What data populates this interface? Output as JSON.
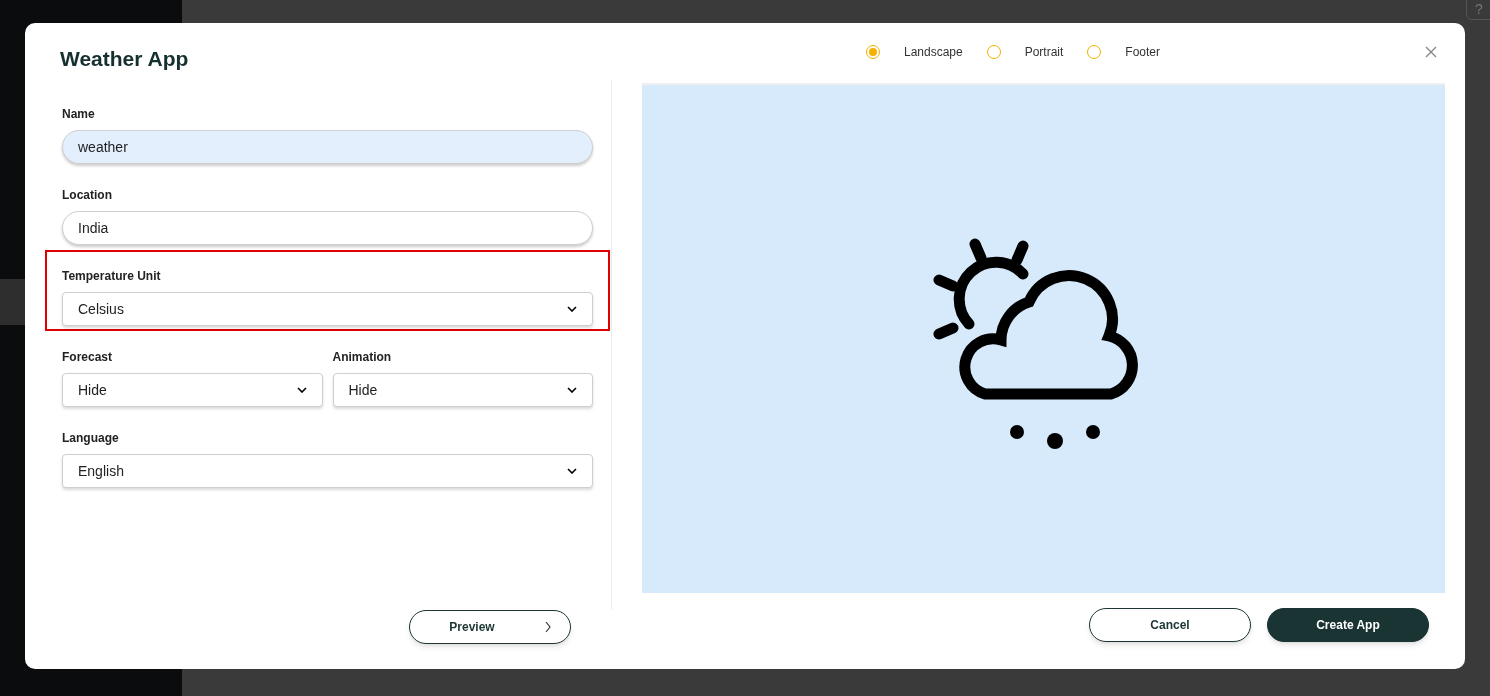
{
  "background": {
    "help_button": "?"
  },
  "dialog": {
    "title": "Weather App",
    "orientations": [
      {
        "label": "Landscape",
        "selected": true
      },
      {
        "label": "Portrait",
        "selected": false
      },
      {
        "label": "Footer",
        "selected": false
      }
    ],
    "fields": [
      {
        "kind": "text",
        "label": "Name",
        "value": "weather",
        "focused": true,
        "highlighted": false
      },
      {
        "kind": "text",
        "label": "Location",
        "value": "India",
        "focused": false,
        "highlighted": false
      },
      {
        "kind": "select",
        "label": "Temperature Unit",
        "value": "Celsius",
        "focused": false,
        "highlighted": true
      },
      {
        "kind": "select-pair",
        "items": [
          {
            "label": "Forecast",
            "value": "Hide"
          },
          {
            "label": "Animation",
            "value": "Hide"
          }
        ]
      },
      {
        "kind": "select",
        "label": "Language",
        "value": "English",
        "focused": false,
        "highlighted": false
      }
    ],
    "preview_button": "Preview",
    "buttons": [
      {
        "label": "Cancel",
        "kind": "secondary"
      },
      {
        "label": "Create App",
        "kind": "primary"
      }
    ]
  }
}
